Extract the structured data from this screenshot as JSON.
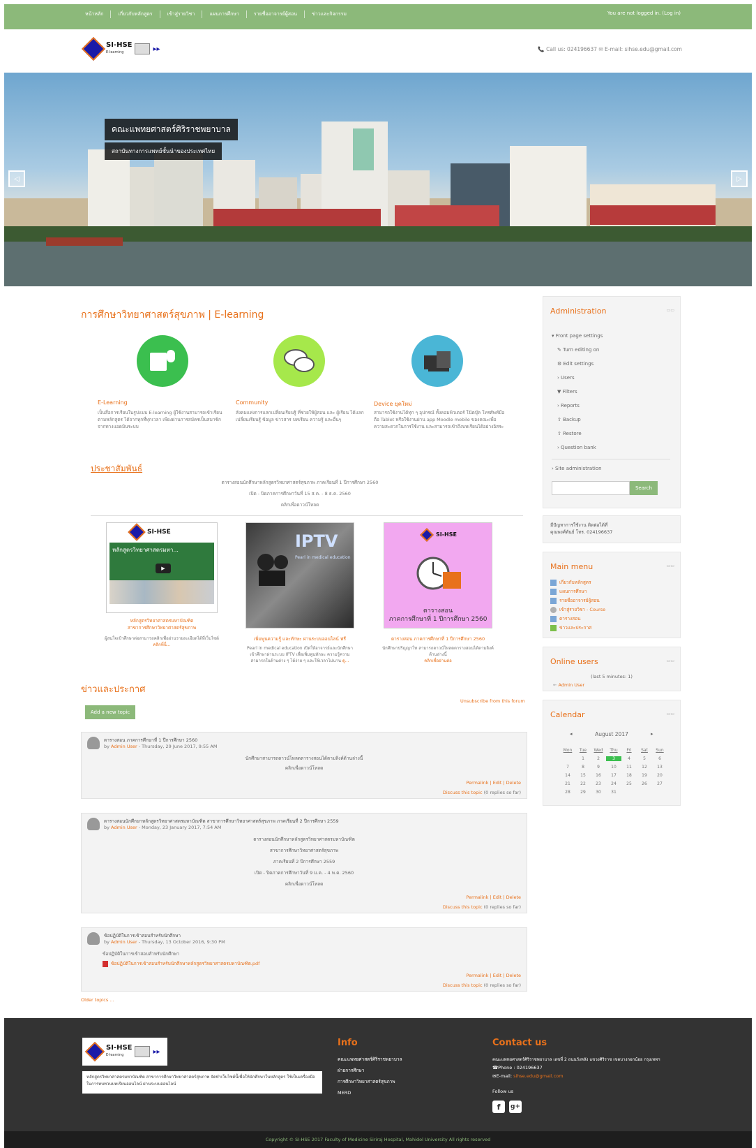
{
  "topnav": {
    "items": [
      "หน้าหลัก",
      "เกี่ยวกับหลักสูตร",
      "เข้าสู่รายวิชา",
      "แผนการศึกษา",
      "รายชื่ออาจารย์ผู้สอน",
      "ข่าวและกิจกรรม"
    ],
    "login_text": "You are not logged in. (Log in)"
  },
  "header": {
    "logo_text": "SI-HSE",
    "logo_sub": "E-learning",
    "contact": "📞 Call us: 024196637   ✉ E-mail: sihse.edu@gmail.com"
  },
  "hero": {
    "title": "คณะแพทยศาสตร์ศิริราชพยาบาล",
    "subtitle": "สถาบันทางการแพทย์ชั้นนำของประเทศไทย",
    "prev": "◁",
    "next": "▷"
  },
  "main": {
    "title": "การศึกษาวิทยาศาสตร์สุขภาพ | E-learning",
    "features": [
      {
        "title": "E-Learning",
        "text": "เป็นสื่อการเรียนในรูปแบบ E-learning ผู้ใช้งานสามารถเข้าเรียนตามหลักสูตร ได้จากทุกที่ทุกเวลา เพียงผ่านการสมัครเป็นสมาชิก จากทางแอดมินระบบ",
        "color": "#3bbf4f"
      },
      {
        "title": "Community",
        "text": "สังคมแห่งการแลกเปลี่ยนเรียนรู้ ที่ช่วยให้ผู้สอน และ ผู้เรียน ได้แลกเปลี่ยนเรียนรู้ ข้อมูล ข่าวสาร บทเรียน ความรู้ และอื่นๆ",
        "color": "#a6e84b"
      },
      {
        "title": "Device ยุคใหม่",
        "text": "สามารถใช้งานได้ทุก ๆ อุปกรณ์ ทั้งคอมพิวเตอร์ โน๊ตบุ๊ค โทรศัพท์มือถือ Tablet หรือใช้งานผ่าน app Moodle mobile ของคณะเพื่อความสะดวกในการใช้งาน และสามารถเข้าถึงบทเรียนได้อย่างอิสระ",
        "color": "#4ab6d6"
      }
    ],
    "pr_title": "ประชาสัมพันธ์",
    "pr_lines": [
      "ตารางสอนนักศึกษาหลักสูตรวิทยาศาสตร์สุขภาพ ภาคเรียนที่ 1 ปีการศึกษา 2560",
      "เปิด - ปิดภาคการศึกษาวันที่ 15 ส.ค. - 8 ธ.ค. 2560"
    ],
    "pr_link": "คลิกเพื่อดาวน์โหลด",
    "cards": [
      {
        "caption1": "หลักสูตรวิทยาศาสตรมหาบัณฑิต",
        "caption2": "สาขาการศึกษาวิทยาศาสตร์สุขภาพ",
        "text": "ผู้สนใจเข้าศึกษาต่อสามารถคลิกเพื่ออ่านรายละเอียดได้ที่เว็บไซต์",
        "link": "คลิกที่นี่..."
      },
      {
        "caption1": "เพิ่มพูนความรู้ และทักษะ ผ่านระบบออนไลน์ ฟรี",
        "caption2": "",
        "text": "Pearl in medical education เปิดให้อาจารย์และนักศึกษาเข้าศึกษาผ่านระบบ IPTV เพื่อเพิ่มพูนทักษะ ความรู้ความสามารถในด้านต่าง ๆ ได้ง่าย ๆ และใช้เวลาไม่นาน",
        "link": "ดู..."
      },
      {
        "caption1": "ตารางสอน ภาคการศึกษาที่ 1 ปีการศึกษา 2560",
        "caption2": "",
        "text": "นักศึกษาปริญญาโท สามารถดาวน์โหลดตารางสอนได้ตามลิงค์ด้านล่างนี้",
        "link": "คลิกเพื่ออ่านต่อ"
      }
    ],
    "iptv": "IPTV",
    "iptv_sub": "Pearl in medical education",
    "calendar_card_logo": "SI-HSE",
    "calendar_card_text1": "ตารางสอน",
    "calendar_card_text2": "ภาคการศึกษาที่ 1 ปีการศึกษา 2560",
    "video_title": "หลักสูตรวิทยาศาสตรมหา..."
  },
  "news": {
    "title": "ข่าวและประกาศ",
    "add_topic": "Add a new topic",
    "unsubscribe": "Unsubscribe from this forum",
    "posts": [
      {
        "subject": "ตารางสอน ภาคการศึกษาที่ 1 ปีการศึกษา 2560",
        "by": "by ",
        "author": "Admin User",
        "date": " - Thursday, 29 June 2017, 9:55 AM",
        "lines": [
          "นักศึกษาสามารถดาวน์โหลดตารางสอนได้ตามลิงค์ด้านล่างนี้"
        ],
        "link": "คลิกเพื่อดาวน์โหลด"
      },
      {
        "subject": "ตารางสอนนักศึกษาหลักสูตรวิทยาศาสตรมหาบัณฑิต สาขาการศึกษาวิทยาศาสตร์สุขภาพ ภาคเรียนที่ 2 ปีการศึกษา 2559",
        "by": "by ",
        "author": "Admin User",
        "date": " - Monday, 23 January 2017, 7:54 AM",
        "lines": [
          "ตารางสอนนักศึกษาหลักสูตรวิทยาศาสตรมหาบัณฑิต",
          "สาขาการศึกษาวิทยาศาสตร์สุขภาพ",
          "ภาคเรียนที่ 2 ปีการศึกษา 2559",
          "เปิด - ปิดภาคการศึกษาวันที่ 9 ม.ค. - 4 พ.ค. 2560"
        ],
        "link": "คลิกเพื่อดาวน์โหลด"
      },
      {
        "subject": "ข้อปฏิบัติในการเข้าสอบสำหรับนักศึกษา",
        "by": "by ",
        "author": "Admin User",
        "date": " - Thursday, 13 October 2016, 9:30 PM",
        "lines": [
          "ข้อปฏิบัติในการเข้าสอบสำหรับนักศึกษา"
        ],
        "link": "ข้อปฏิบัติในการเข้าสอบสำหรับนักศึกษาหลักสูตรวิทยาศาสตรมหาบัณฑิต.pdf"
      }
    ],
    "permalink": "Permalink",
    "edit": "Edit",
    "delete": "Delete",
    "discuss": "Discuss this topic",
    "replies": " (0 replies so far)",
    "older": "Older topics ..."
  },
  "sidebar": {
    "admin_title": "Administration",
    "admin_items": [
      "▾ Front page settings",
      "✎ Turn editing on",
      "⚙ Edit settings",
      "› Users",
      "▼ Filters",
      "› Reports",
      "⇧ Backup",
      "⇧ Restore",
      "› Question bank"
    ],
    "site_admin": "› Site administration",
    "search_button": "Search",
    "help_text1": "มีปัญหาการใช้งาน ติดต่อได้ที่",
    "help_text2": "คุณพงศ์พันธ์ โทร. 024196637",
    "menu_title": "Main menu",
    "menu_items": [
      "เกี่ยวกับหลักสูตร",
      "แผนการศึกษา",
      "รายชื่ออาจารย์ผู้สอน",
      "เข้าสู่รายวิชา - Course",
      "ตารางสอน",
      "ข่าวและประกาศ"
    ],
    "online_title": "Online users",
    "online_text": "(last 5 minutes: 1)",
    "online_user": "Admin User",
    "calendar_title": "Calendar",
    "calendar_month": "August 2017",
    "calendar_prev": "◂",
    "calendar_next": "▸",
    "calendar_days": [
      "Mon",
      "Tue",
      "Wed",
      "Thu",
      "Fri",
      "Sat",
      "Sun"
    ],
    "calendar_weeks": [
      [
        "",
        "1",
        "2",
        "3",
        "4",
        "5",
        "6"
      ],
      [
        "7",
        "8",
        "9",
        "10",
        "11",
        "12",
        "13"
      ],
      [
        "14",
        "15",
        "16",
        "17",
        "18",
        "19",
        "20"
      ],
      [
        "21",
        "22",
        "23",
        "24",
        "25",
        "26",
        "27"
      ],
      [
        "28",
        "29",
        "30",
        "31",
        "",
        "",
        ""
      ]
    ],
    "block_ctl": "▭▭"
  },
  "footer": {
    "about": "หลักสูตรวิทยาศาสตรมหาบัณฑิต สาขาการศึกษาวิทยาศาสตร์สุขภาพ จัดทำเว็บไซต์นี้เพื่อให้นักศึกษาในหลักสูตร ใช้เป็นเครื่องมือในการทบทวนบทเรียนออนไลน์ ผ่านระบบออนไลน์",
    "info_title": "Info",
    "info_links": [
      "คณะแพทยศาสตร์ศิริราชพยาบาล",
      "ฝ่ายการศึกษา",
      "การศึกษาวิทยาศาสตร์สุขภาพ",
      "MERD"
    ],
    "contact_title": "Contact us",
    "address": "คณะแพทยศาสตร์ศิริราชพยาบาล เลขที่ 2 ถนนวังหลัง แขวงศิริราช เขตบางกอกน้อย กรุงเทพฯ",
    "phone_label": "☎Phone : ",
    "phone": "024196637",
    "email_label": "✉E-mail: ",
    "email": "sihse.edu@gmail.com",
    "follow": "Follow us",
    "fb": "f",
    "gplus": "g+",
    "copyright": "Copyright © SI-HSE 2017 Faculty of Medicine Siriraj Hospital, Mahidol University All rights reserved"
  }
}
